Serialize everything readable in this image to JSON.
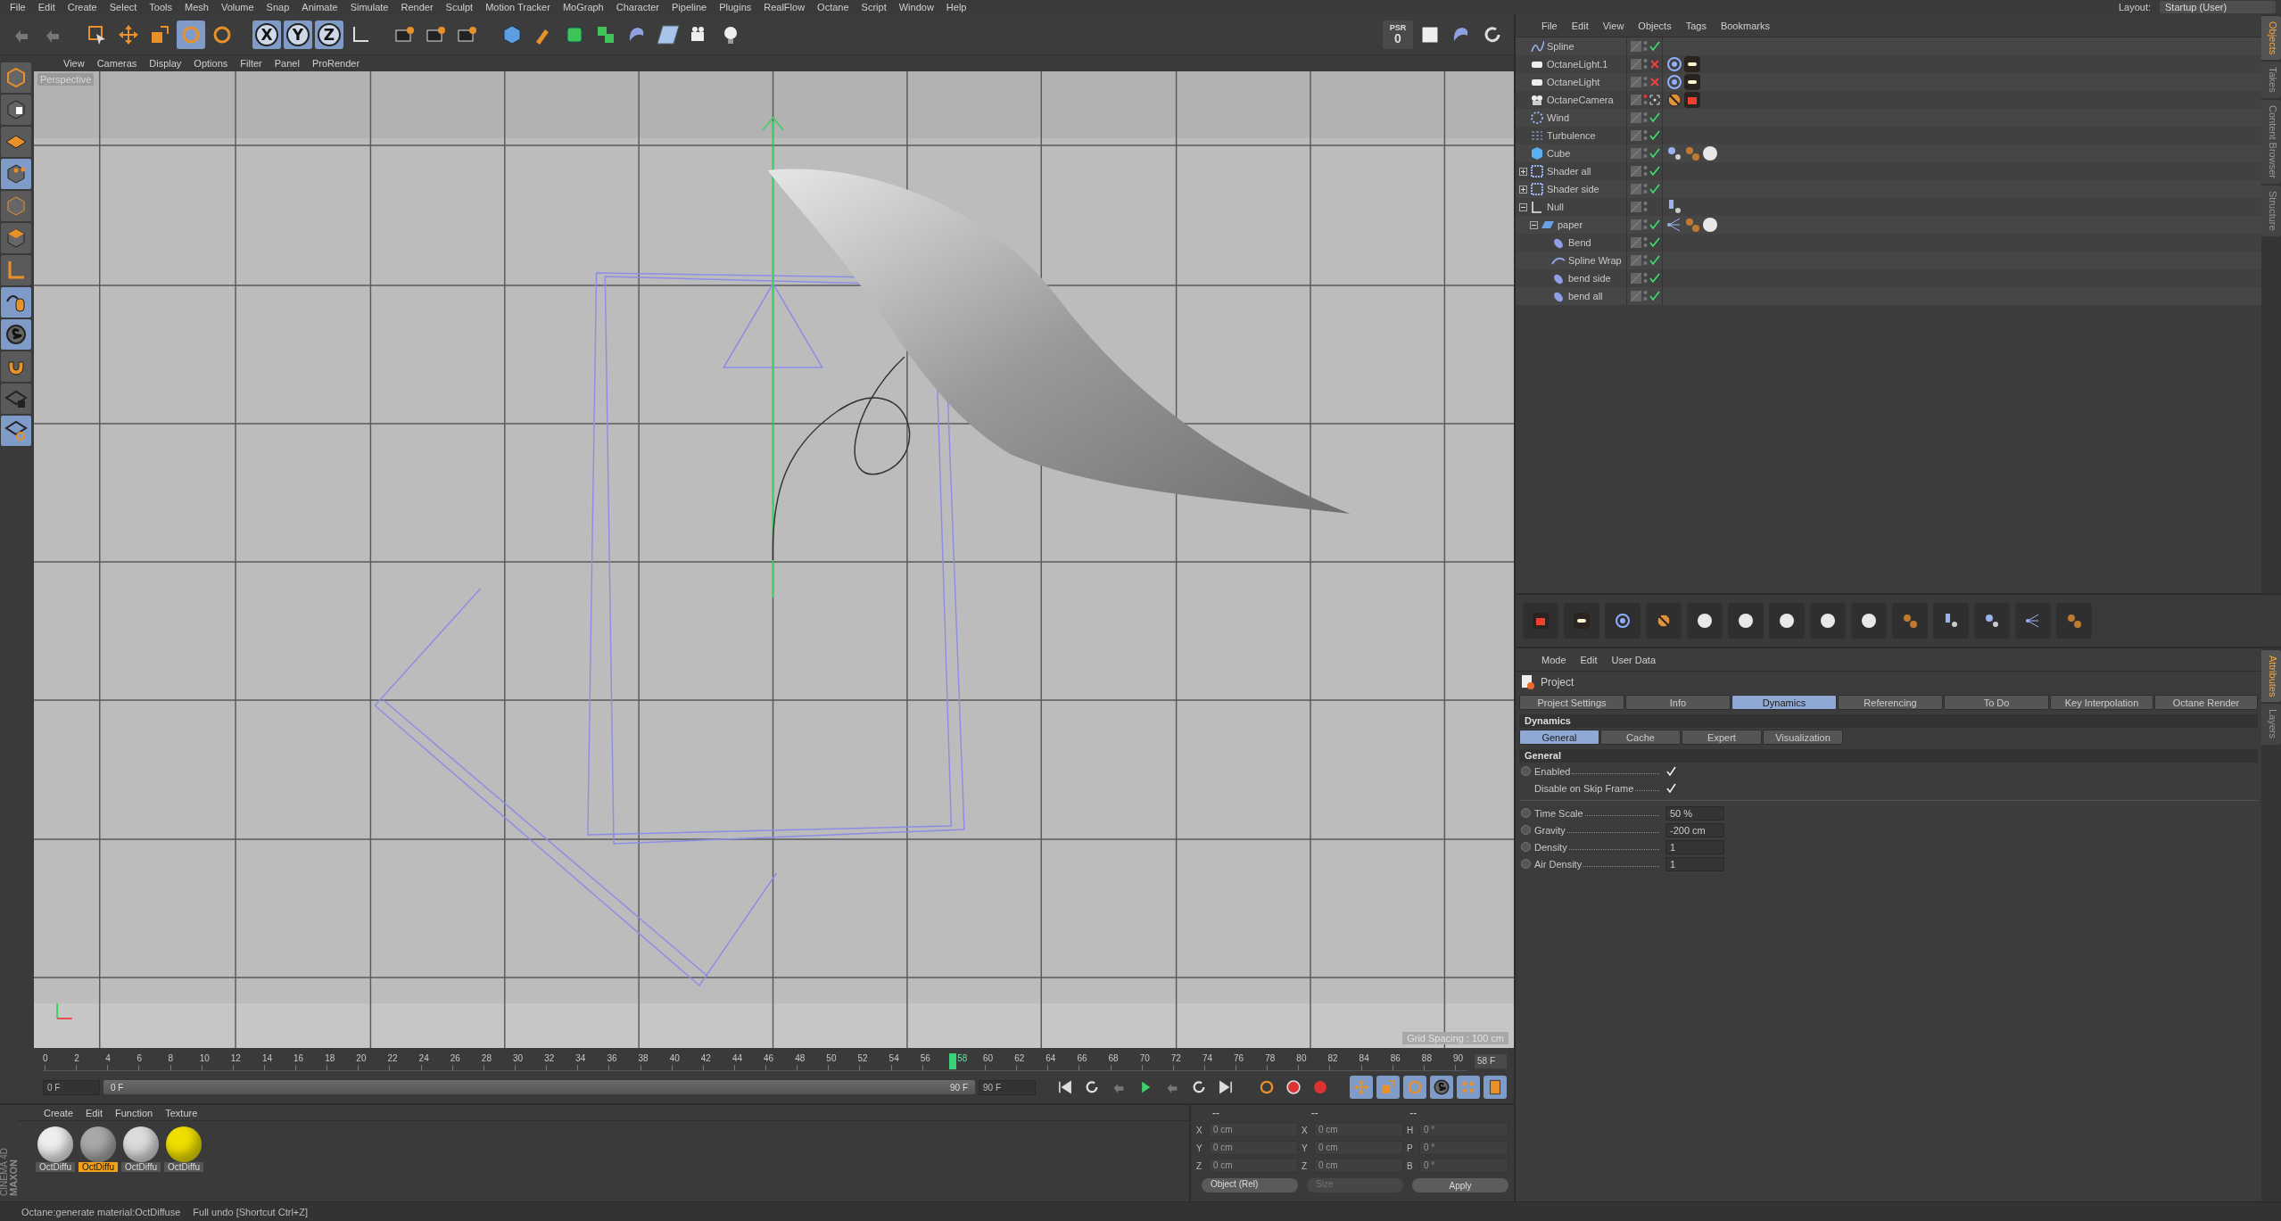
{
  "menu_bar": {
    "items": [
      "File",
      "Edit",
      "Create",
      "Select",
      "Tools",
      "Mesh",
      "Volume",
      "Snap",
      "Animate",
      "Simulate",
      "Render",
      "Sculpt",
      "Motion Tracker",
      "MoGraph",
      "Character",
      "Pipeline",
      "Plugins",
      "RealFlow",
      "Octane",
      "Script",
      "Window",
      "Help"
    ],
    "layout_label": "Layout:",
    "layout_value": "Startup (User)"
  },
  "toolbar": {
    "axis_buttons": [
      {
        "label": "X",
        "selected": true
      },
      {
        "label": "Y",
        "selected": true
      },
      {
        "label": "Z",
        "selected": true
      }
    ],
    "psr": {
      "label": "PSR",
      "value": "0"
    }
  },
  "left_tools": [
    {
      "kind": "model",
      "selected": false
    },
    {
      "kind": "texture",
      "selected": false
    },
    {
      "kind": "workplane",
      "selected": false
    },
    {
      "kind": "points",
      "selected": true
    },
    {
      "kind": "edges",
      "selected": false
    },
    {
      "kind": "polygons",
      "selected": false
    },
    {
      "kind": "axis",
      "selected": false
    },
    {
      "kind": "tweak",
      "selected": true
    },
    {
      "kind": "solo",
      "selected": true
    },
    {
      "kind": "snap",
      "selected": false
    },
    {
      "kind": "lock",
      "selected": false
    },
    {
      "kind": "planar",
      "selected": true
    }
  ],
  "viewport": {
    "menu": [
      "View",
      "Cameras",
      "Display",
      "Options",
      "Filter",
      "Panel",
      "ProRender"
    ],
    "camera_label": "Perspective",
    "grid_spacing": "Grid Spacing : 100 cm"
  },
  "timeline": {
    "ticks": [
      "0",
      "2",
      "4",
      "6",
      "8",
      "10",
      "12",
      "14",
      "16",
      "18",
      "20",
      "22",
      "24",
      "26",
      "28",
      "30",
      "32",
      "34",
      "36",
      "38",
      "40",
      "42",
      "44",
      "46",
      "48",
      "50",
      "52",
      "54",
      "56",
      "60",
      "62",
      "64",
      "66",
      "68",
      "70",
      "72",
      "74",
      "76",
      "78",
      "80",
      "82",
      "84",
      "86",
      "88",
      "90"
    ],
    "playhead": {
      "label": "58",
      "level": 0.644
    },
    "current_field": "58 F",
    "start_field": "0 F",
    "range": {
      "start": "0 F",
      "end": "90 F",
      "level": 1
    },
    "end_field": "90 F"
  },
  "objects": [
    {
      "name": "Spline",
      "kind": "spline",
      "enabled": true
    },
    {
      "name": "OctaneLight.1",
      "kind": "light",
      "enabled": false,
      "tags": [
        {
          "kind": "octane-target"
        },
        {
          "kind": "light-tag"
        }
      ]
    },
    {
      "name": "OctaneLight",
      "kind": "light",
      "enabled": false,
      "tags": [
        {
          "kind": "octane-target"
        },
        {
          "kind": "light-tag"
        }
      ]
    },
    {
      "name": "OctaneCamera",
      "kind": "camera",
      "tags": [
        {
          "kind": "blocked"
        },
        {
          "kind": "camera-tag"
        }
      ]
    },
    {
      "name": "Wind",
      "kind": "wind",
      "enabled": true
    },
    {
      "name": "Turbulence",
      "kind": "turbulence",
      "enabled": true
    },
    {
      "name": "Cube",
      "kind": "cube",
      "enabled": true,
      "tags": [
        {
          "kind": "dynamics"
        },
        {
          "kind": "spheres"
        },
        {
          "kind": "material"
        }
      ]
    },
    {
      "name": "Shader all",
      "kind": "shader",
      "enabled": true,
      "expanded": false
    },
    {
      "name": "Shader side",
      "kind": "shader",
      "enabled": true,
      "expanded": false
    },
    {
      "name": "Null",
      "kind": "null",
      "expanded": true,
      "tags": [
        {
          "kind": "display"
        }
      ],
      "children": [
        {
          "name": "paper",
          "kind": "plane",
          "enabled": true,
          "expanded": true,
          "tags": [
            {
              "kind": "connector"
            },
            {
              "kind": "spheres"
            },
            {
              "kind": "material"
            }
          ],
          "children": [
            {
              "name": "Bend",
              "kind": "deformer",
              "enabled": true
            },
            {
              "name": "Spline Wrap",
              "kind": "wrap",
              "enabled": true
            },
            {
              "name": "bend side",
              "kind": "deformer",
              "enabled": true
            },
            {
              "name": "bend all",
              "kind": "deformer",
              "enabled": true
            }
          ]
        }
      ]
    }
  ],
  "object_menu": [
    "File",
    "Edit",
    "View",
    "Objects",
    "Tags",
    "Bookmarks"
  ],
  "side_tabs_top": [
    {
      "label": "Objects",
      "selected": true
    },
    {
      "label": "Takes",
      "selected": false
    },
    {
      "label": "Content Browser",
      "selected": false
    },
    {
      "label": "Structure",
      "selected": false
    }
  ],
  "side_tabs_bottom": [
    {
      "label": "Attributes",
      "selected": true
    },
    {
      "label": "Layers",
      "selected": false
    }
  ],
  "attributes": {
    "menu": [
      "Mode",
      "Edit",
      "User Data"
    ],
    "title": "Project",
    "tabs": [
      {
        "label": "Project Settings",
        "selected": false
      },
      {
        "label": "Info",
        "selected": false
      },
      {
        "label": "Dynamics",
        "selected": true
      },
      {
        "label": "Referencing",
        "selected": false
      },
      {
        "label": "To Do",
        "selected": false
      },
      {
        "label": "Key Interpolation",
        "selected": false
      },
      {
        "label": "Octane Render",
        "selected": false
      }
    ],
    "section": "Dynamics",
    "subtabs": [
      {
        "label": "General",
        "selected": true
      },
      {
        "label": "Cache",
        "selected": false
      },
      {
        "label": "Expert",
        "selected": false
      },
      {
        "label": "Visualization",
        "selected": false
      }
    ],
    "group": "General",
    "checks": [
      {
        "label": "Enabled",
        "checked": true,
        "animatable": true
      },
      {
        "label": "Disable on Skip Frame",
        "checked": true,
        "animatable": false
      }
    ],
    "fields": [
      {
        "label": "Time Scale",
        "value": "50 %"
      },
      {
        "label": "Gravity",
        "value": "-200 cm"
      },
      {
        "label": "Density",
        "value": "1"
      },
      {
        "label": "Air Density",
        "value": "1"
      }
    ]
  },
  "materials": {
    "menu": [
      "Create",
      "Edit",
      "Function",
      "Texture"
    ],
    "brand": [
      "MAXON",
      "CINEMA 4D"
    ],
    "items": [
      {
        "name": "OctDiffu",
        "color": "#eeeeee",
        "selected": false
      },
      {
        "name": "OctDiffu",
        "color": "#a8a8a8",
        "selected": true
      },
      {
        "name": "OctDiffu",
        "color": "#dcdcdc",
        "selected": false
      },
      {
        "name": "OctDiffu",
        "color": "#f0e000",
        "selected": false
      }
    ]
  },
  "coordinates": {
    "headers": [
      "--",
      "--",
      "--"
    ],
    "rows": [
      [
        {
          "axis": "X",
          "value": "0 cm"
        },
        {
          "axis": "X",
          "value": "0 cm"
        },
        {
          "axis": "H",
          "value": "0 °"
        }
      ],
      [
        {
          "axis": "Y",
          "value": "0 cm"
        },
        {
          "axis": "Y",
          "value": "0 cm"
        },
        {
          "axis": "P",
          "value": "0 °"
        }
      ],
      [
        {
          "axis": "Z",
          "value": "0 cm"
        },
        {
          "axis": "Z",
          "value": "0 cm"
        },
        {
          "axis": "B",
          "value": "0 °"
        }
      ]
    ],
    "mode": "Object (Rel)",
    "size_mode": "Size",
    "size_disabled": true,
    "apply": "Apply"
  },
  "status_bar": [
    "Octane:generate material:OctDiffuse",
    "Full undo [Shortcut Ctrl+Z]"
  ]
}
